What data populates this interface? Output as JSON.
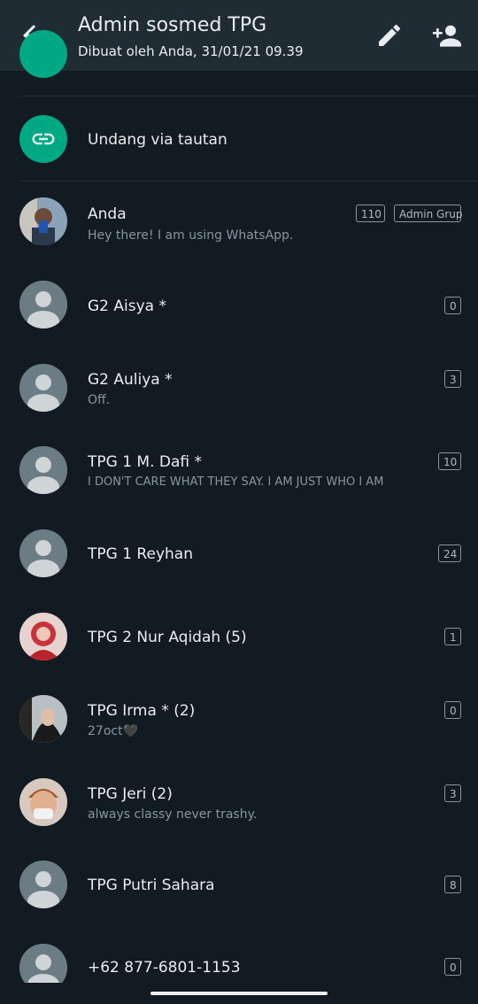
{
  "header": {
    "title": "Admin sosmed TPG",
    "subtitle": "Dibuat oleh Anda, 31/01/21 09.39",
    "back_icon": "arrow-left-icon",
    "edit_icon": "pencil-icon",
    "add_icon": "add-person-icon"
  },
  "invite": {
    "label": "Undang via tautan",
    "icon": "link-icon",
    "color": "#00a884"
  },
  "members": [
    {
      "name": "Anda",
      "status": "Hey there! I am using WhatsApp.",
      "count": "110",
      "role": "Admin Grup",
      "avatar": "photo"
    },
    {
      "name": "G2 Aisya *",
      "status": "",
      "count": "0",
      "avatar": "default"
    },
    {
      "name": "G2 Auliya *",
      "status": "Off.",
      "count": "3",
      "avatar": "default"
    },
    {
      "name": "TPG 1 M. Dafi *",
      "status": "I DON'T CARE WHAT THEY SAY. I AM JUST WHO I AM",
      "count": "10",
      "avatar": "default"
    },
    {
      "name": "TPG 1 Reyhan",
      "status": "",
      "count": "24",
      "avatar": "default"
    },
    {
      "name": "TPG 2 Nur Aqidah (5)",
      "status": "",
      "count": "1",
      "avatar": "photo"
    },
    {
      "name": "TPG Irma * (2)",
      "status": "27oct🖤",
      "count": "0",
      "avatar": "photo"
    },
    {
      "name": "TPG Jeri (2)",
      "status": "always classy never trashy.",
      "count": "3",
      "avatar": "photo"
    },
    {
      "name": "TPG Putri Sahara",
      "status": "",
      "count": "8",
      "avatar": "default"
    },
    {
      "name": "+62 877-6801-1153",
      "status": "",
      "count": "0",
      "avatar": "default"
    }
  ],
  "colors": {
    "background": "#121b22",
    "header": "#1f2c34",
    "accent": "#00a884",
    "secondary_text": "#8696a0"
  }
}
